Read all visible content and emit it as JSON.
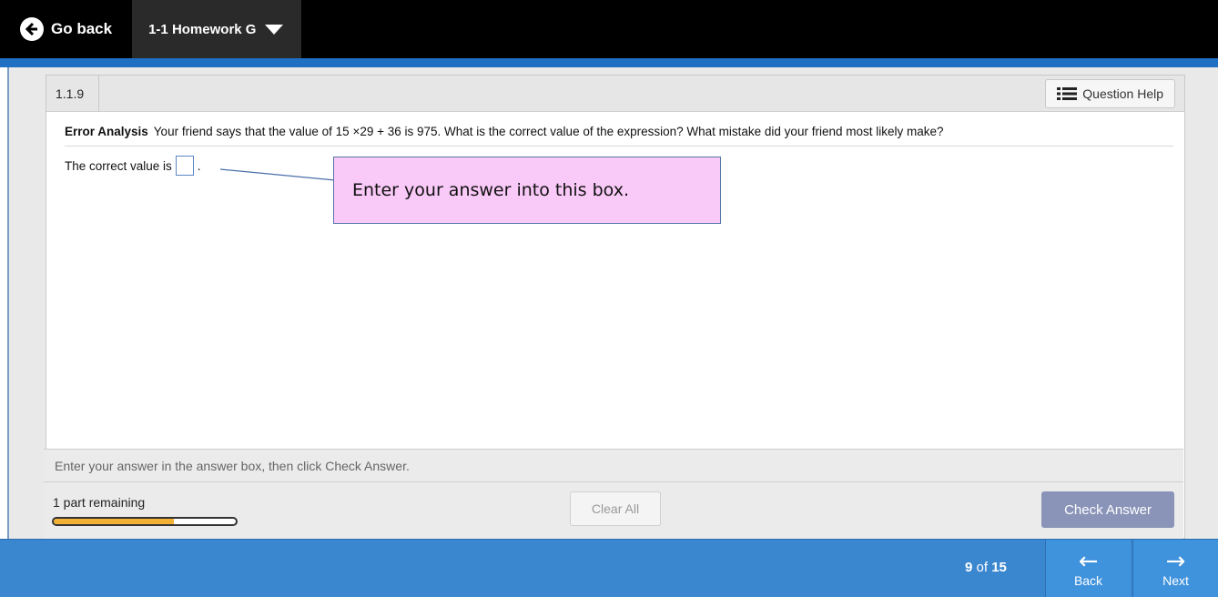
{
  "topbar": {
    "go_back_label": "Go back",
    "assignment_label": "1-1 Homework G"
  },
  "question": {
    "number": "1.1.9",
    "help_label": "Question Help",
    "prompt_bold": "Error Analysis",
    "prompt_text": "Your friend says that the value of 15 ×29 + 36 is 975. What is the correct value of the expression? What mistake did your friend most likely make?",
    "answer_prefix": "The correct value is",
    "answer_suffix": ".",
    "callout_text": "Enter your answer into this box."
  },
  "bottom": {
    "instruction": "Enter your answer in the answer box, then click Check Answer.",
    "remaining": "1 part remaining",
    "progress_fraction": 0.66,
    "clear_all_label": "Clear All",
    "check_answer_label": "Check Answer"
  },
  "footer": {
    "current": "9",
    "of_word": "of",
    "total": "15",
    "back_label": "Back",
    "next_label": "Next"
  },
  "colors": {
    "top_bar": "#000000",
    "accent_blue": "#1f6fc2",
    "footer_blue": "#3b87cf",
    "callout_pink": "#f9c9f7",
    "progress_fill": "#f2b134",
    "check_answer": "#8a94b8"
  }
}
